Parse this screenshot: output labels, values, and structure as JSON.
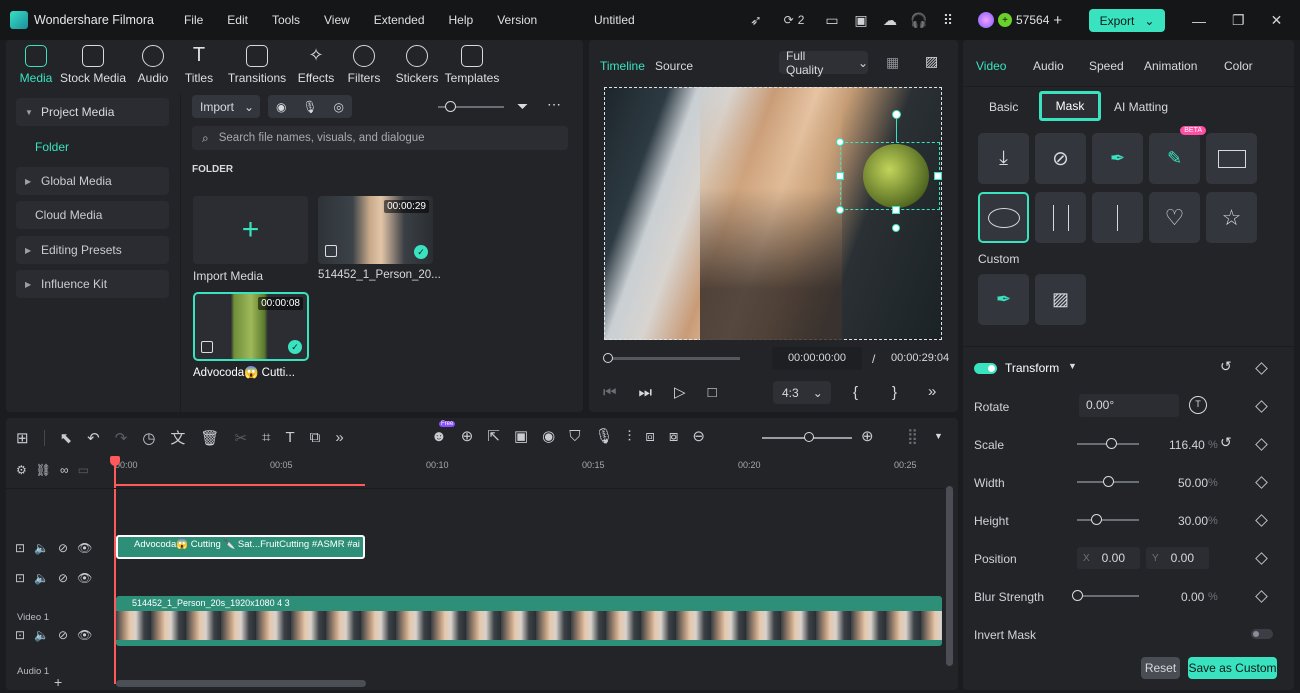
{
  "app": {
    "name": "Wondershare Filmora",
    "doc_title": "Untitled",
    "counter": "2",
    "credits": "57564",
    "export_label": "Export"
  },
  "menu": [
    "File",
    "Edit",
    "Tools",
    "View",
    "Extended",
    "Help",
    "Version"
  ],
  "media_tabs": [
    "Media",
    "Stock Media",
    "Audio",
    "Titles",
    "Transitions",
    "Effects",
    "Filters",
    "Stickers",
    "Templates"
  ],
  "sidebar": {
    "project_media": "Project Media",
    "folder": "Folder",
    "global_media": "Global Media",
    "cloud_media": "Cloud Media",
    "editing_presets": "Editing Presets",
    "influence_kit": "Influence Kit"
  },
  "media": {
    "import_label": "Import",
    "search_placeholder": "Search file names, visuals, and dialogue",
    "folder_heading": "FOLDER",
    "import_media_label": "Import Media",
    "items": [
      {
        "name": "514452_1_Person_20...",
        "duration": "00:00:29"
      },
      {
        "name": "Advocoda😱 Cutti...",
        "duration": "00:00:08"
      }
    ]
  },
  "preview": {
    "tab_timeline": "Timeline",
    "tab_source": "Source",
    "quality": "Full Quality",
    "current_time": "00:00:00:00",
    "separator": "/",
    "total_time": "00:00:29:04",
    "ratio": "4:3",
    "brace_open": "{",
    "brace_close": "}"
  },
  "props": {
    "tabs": [
      "Video",
      "Audio",
      "Speed",
      "Animation",
      "Color"
    ],
    "subtabs": [
      "Basic",
      "Mask",
      "AI Matting"
    ],
    "beta": "BETA",
    "custom_label": "Custom",
    "transform_label": "Transform",
    "rotate_label": "Rotate",
    "rotate_value": "0.00°",
    "scale_label": "Scale",
    "scale_value": "116.40",
    "scale_level": 0.55,
    "width_label": "Width",
    "width_value": "50.00",
    "width_level": 0.5,
    "height_label": "Height",
    "height_value": "30.00",
    "height_level": 0.3,
    "position_label": "Position",
    "pos_x_label": "X",
    "pos_x": "0.00",
    "pos_y_label": "Y",
    "pos_y": "0.00",
    "blur_label": "Blur Strength",
    "blur_value": "0.00",
    "blur_level": 0,
    "invert_label": "Invert Mask",
    "pct": "%",
    "reset_label": "Reset",
    "save_custom_label": "Save as Custom"
  },
  "timeline": {
    "ruler": [
      "00:00",
      "00:05",
      "00:10",
      "00:15",
      "00:20",
      "00:25"
    ],
    "clip_top": "Advocoda😱 Cutting 🔪 Sat...FruitCutting #ASMR #ai",
    "clip_main": "514452_1_Person_20s_1920x1080 4 3",
    "video1_label": "Video 1",
    "audio1_label": "Audio 1",
    "free_badge": "Free"
  },
  "colors": {
    "accent": "#39e3c0",
    "playhead": "#ff5a5a",
    "clip_green": "#2e8f78"
  }
}
